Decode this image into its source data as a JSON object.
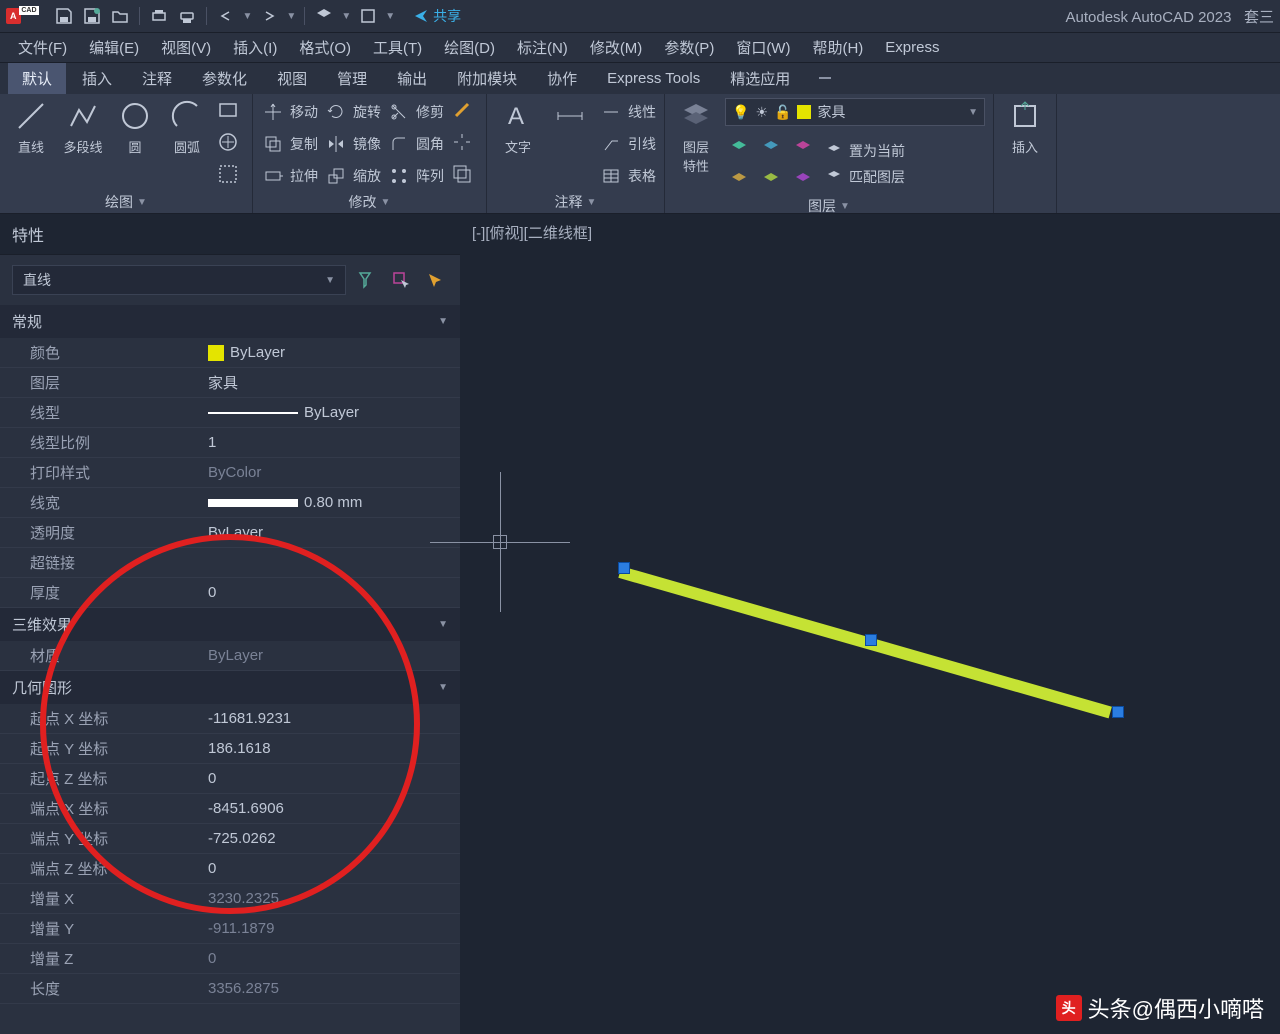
{
  "app": {
    "title": "Autodesk AutoCAD 2023",
    "doc": "套三"
  },
  "share": "共享",
  "menus": [
    "文件(F)",
    "编辑(E)",
    "视图(V)",
    "插入(I)",
    "格式(O)",
    "工具(T)",
    "绘图(D)",
    "标注(N)",
    "修改(M)",
    "参数(P)",
    "窗口(W)",
    "帮助(H)",
    "Express"
  ],
  "ribbon_tabs": [
    "默认",
    "插入",
    "注释",
    "参数化",
    "视图",
    "管理",
    "输出",
    "附加模块",
    "协作",
    "Express Tools",
    "精选应用"
  ],
  "ribbon": {
    "draw": {
      "title": "绘图",
      "line": "直线",
      "polyline": "多段线",
      "circle": "圆",
      "arc": "圆弧"
    },
    "modify": {
      "title": "修改",
      "move": "移动",
      "rotate": "旋转",
      "trim": "修剪",
      "copy": "复制",
      "mirror": "镜像",
      "fillet": "圆角",
      "stretch": "拉伸",
      "scale": "缩放",
      "array": "阵列"
    },
    "annotate": {
      "title": "注释",
      "text": "文字",
      "linear": "线性",
      "leader": "引线",
      "table": "表格"
    },
    "layers": {
      "title": "图层",
      "layerprop": "图层\n特性",
      "current": "家具",
      "setcurrent": "置为当前",
      "match": "匹配图层"
    },
    "insert": {
      "title": "插入"
    }
  },
  "viewport_label": "[-][俯视][二维线框]",
  "properties": {
    "panel_title": "特性",
    "object_type": "直线",
    "sections": {
      "general": {
        "title": "常规",
        "rows": {
          "color": {
            "label": "颜色",
            "value": "ByLayer"
          },
          "layer": {
            "label": "图层",
            "value": "家具"
          },
          "linetype": {
            "label": "线型",
            "value": "ByLayer"
          },
          "ltscale": {
            "label": "线型比例",
            "value": "1"
          },
          "plotstyle": {
            "label": "打印样式",
            "value": "ByColor"
          },
          "lineweight": {
            "label": "线宽",
            "value": "0.80 mm"
          },
          "transparency": {
            "label": "透明度",
            "value": "ByLayer"
          },
          "hyperlink": {
            "label": "超链接",
            "value": ""
          },
          "thickness": {
            "label": "厚度",
            "value": "0"
          }
        }
      },
      "threed": {
        "title": "三维效果",
        "rows": {
          "material": {
            "label": "材质",
            "value": "ByLayer"
          }
        }
      },
      "geometry": {
        "title": "几何图形",
        "rows": {
          "sx": {
            "label": "起点 X 坐标",
            "value": "-11681.9231"
          },
          "sy": {
            "label": "起点 Y 坐标",
            "value": "186.1618"
          },
          "sz": {
            "label": "起点 Z 坐标",
            "value": "0"
          },
          "ex": {
            "label": "端点 X 坐标",
            "value": "-8451.6906"
          },
          "ey": {
            "label": "端点 Y 坐标",
            "value": "-725.0262"
          },
          "ez": {
            "label": "端点 Z 坐标",
            "value": "0"
          },
          "dx": {
            "label": "增量 X",
            "value": "3230.2325"
          },
          "dy": {
            "label": "增量 Y",
            "value": "-911.1879"
          },
          "dz": {
            "label": "增量 Z",
            "value": "0"
          },
          "len": {
            "label": "长度",
            "value": "3356.2875"
          }
        }
      }
    }
  },
  "watermark": "头条@偶西小嘀嗒"
}
